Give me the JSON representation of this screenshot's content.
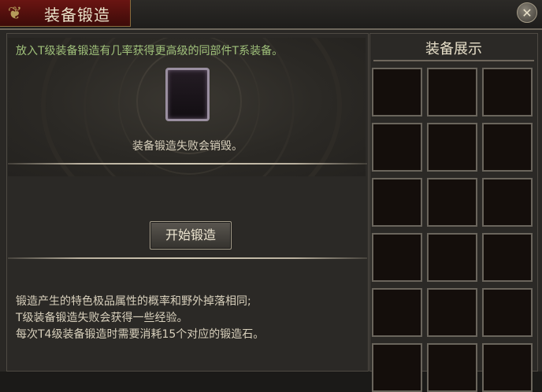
{
  "window": {
    "title": "装备锻造",
    "close_glyph": "✕"
  },
  "forge": {
    "intro": "放入T级装备锻造有几率获得更高级的同部件T系装备。",
    "fail_notice": "装备锻造失败会销毁。",
    "start_button": "开始锻造",
    "notes": [
      "锻造产生的特色极品属性的概率和野外掉落相同;",
      "T级装备锻造失败会获得一些经验。",
      "每次T4级装备锻造时需要消耗15个对应的锻造石。"
    ]
  },
  "display": {
    "title": "装备展示",
    "columns": 3,
    "rows_visible": 6
  },
  "colors": {
    "intro_text": "#9fc07a",
    "body_text": "#d8d0bc",
    "title_tab": "#6a1512"
  }
}
